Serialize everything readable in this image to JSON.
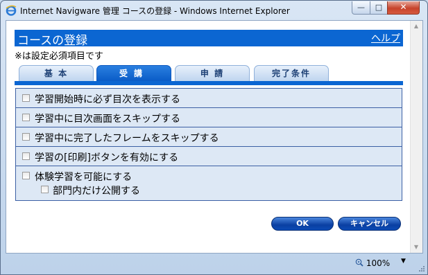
{
  "window": {
    "title": "Internet Navigware 管理 コースの登録 - Windows Internet Explorer",
    "minimize_glyph": "—",
    "maximize_glyph": "□",
    "close_glyph": "✕"
  },
  "page": {
    "title": "コースの登録",
    "help_label": "ヘルプ",
    "required_note": "※は設定必須項目です"
  },
  "tabs": [
    {
      "label": "基 本",
      "active": false
    },
    {
      "label": "受講",
      "active": true
    },
    {
      "label": "申 請",
      "active": false
    },
    {
      "label": "完了条件",
      "active": false
    }
  ],
  "options": [
    {
      "label": "学習開始時に必ず目次を表示する",
      "checked": false
    },
    {
      "label": "学習中に目次画面をスキップする",
      "checked": false
    },
    {
      "label": "学習中に完了したフレームをスキップする",
      "checked": false
    },
    {
      "label": "学習の[印刷]ボタンを有効にする",
      "checked": false
    },
    {
      "label": "体験学習を可能にする",
      "checked": false
    }
  ],
  "sub_option": {
    "label": "部門内だけ公開する",
    "checked": false
  },
  "buttons": {
    "ok": "OK",
    "cancel": "キャンセル"
  },
  "statusbar": {
    "zoom": "100%",
    "zoom_icon": "magnifier-icon"
  },
  "colors": {
    "accent": "#0b66d2",
    "row_bg": "#dde8f5",
    "border": "#3b5fa4"
  }
}
